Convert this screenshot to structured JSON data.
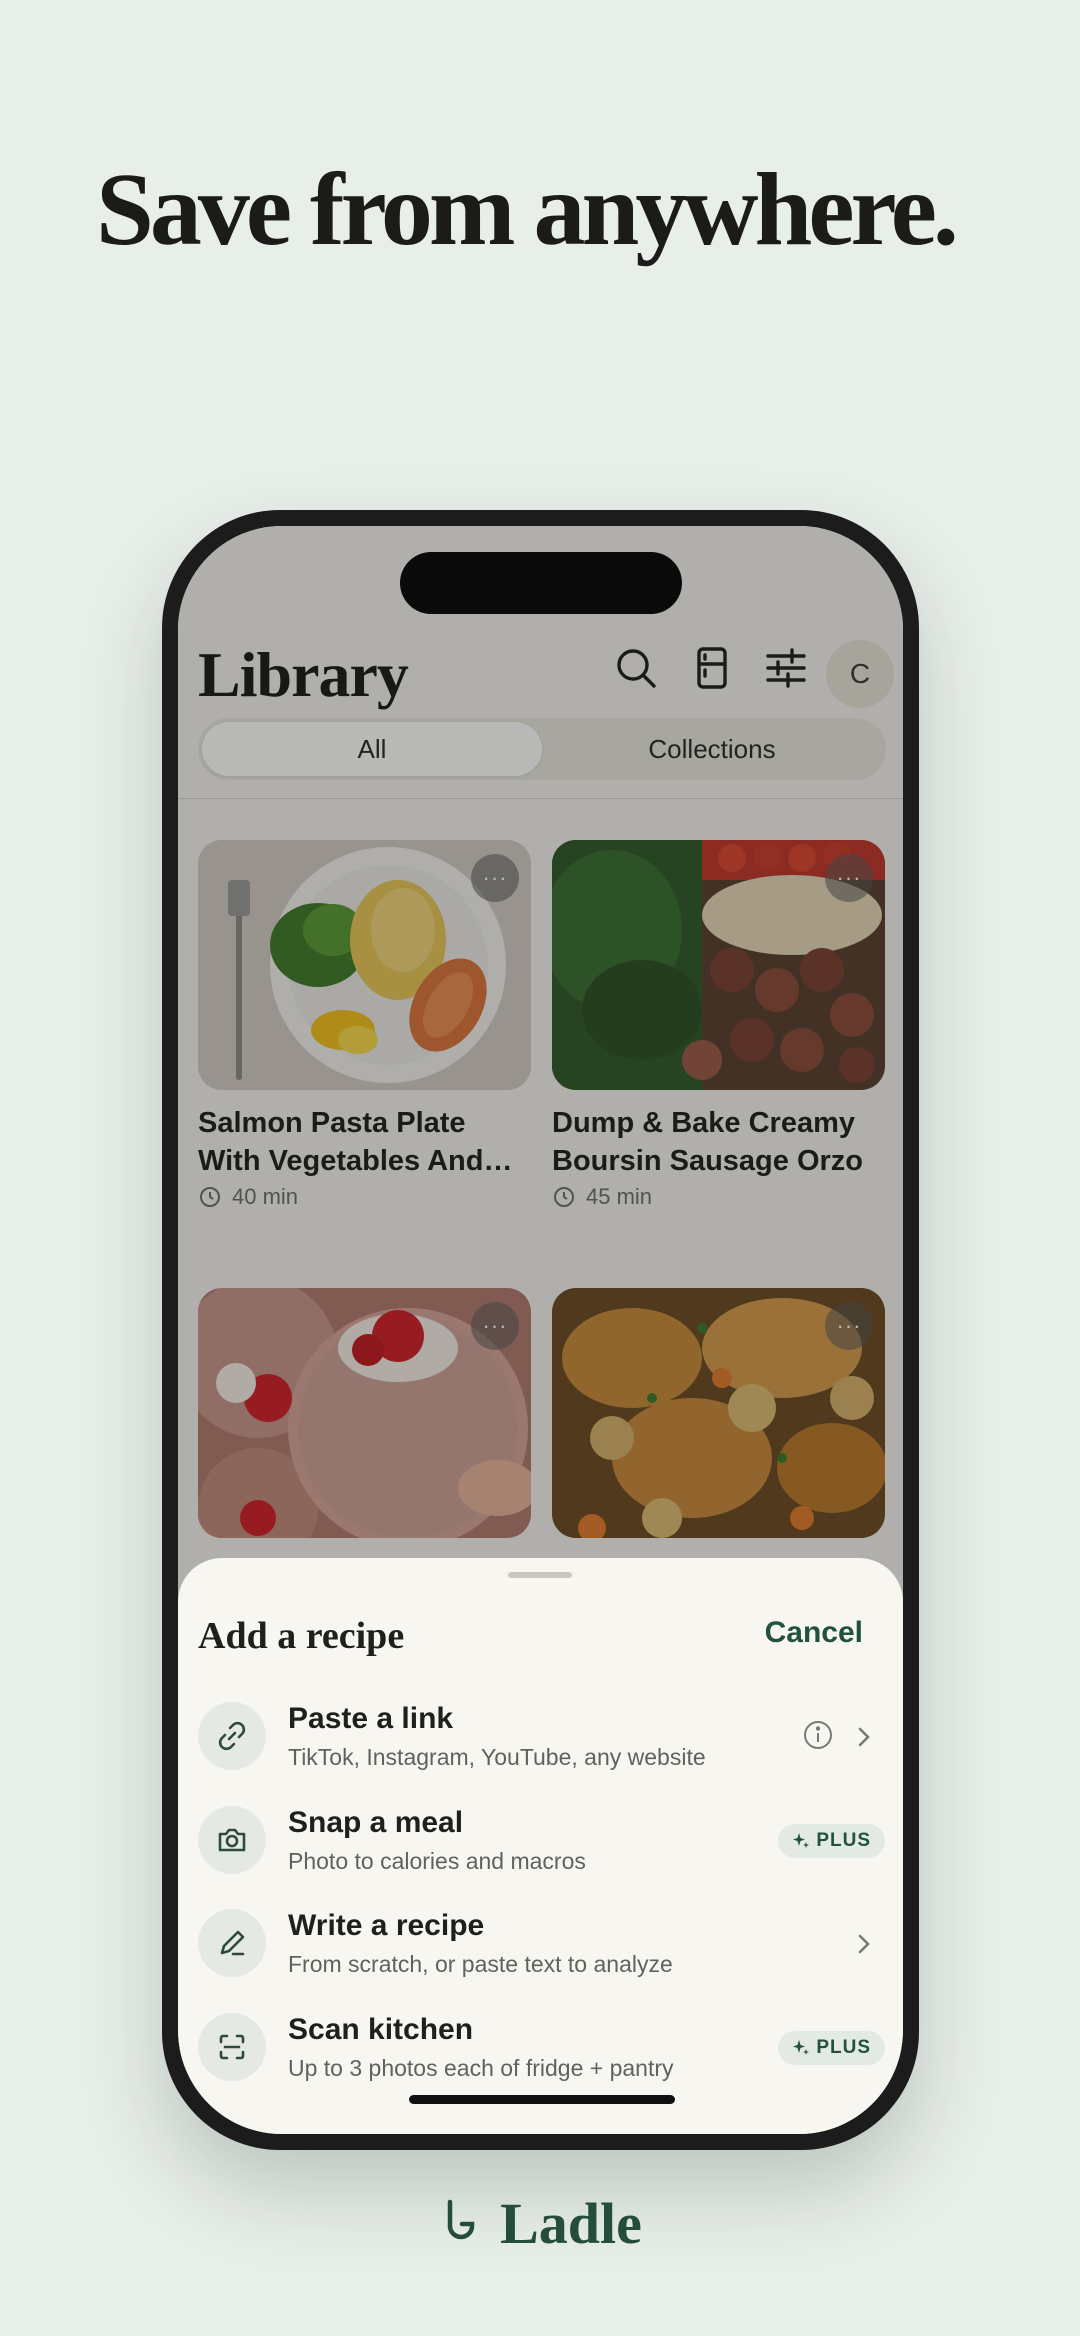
{
  "headline": "Save from anywhere.",
  "library": {
    "title": "Library",
    "avatar_initial": "C",
    "tabs": [
      {
        "label": "All",
        "active": true
      },
      {
        "label": "Collections",
        "active": false
      }
    ],
    "recipes": [
      {
        "title": "Salmon Pasta Plate With Vegetables And…",
        "time": "40 min"
      },
      {
        "title": "Dump & Bake Creamy Boursin Sausage Orzo",
        "time": "45 min"
      },
      {
        "title": "",
        "time": ""
      },
      {
        "title": "",
        "time": ""
      }
    ],
    "more_label": "···"
  },
  "sheet": {
    "title": "Add a recipe",
    "cancel_label": "Cancel",
    "options": [
      {
        "title": "Paste a link",
        "subtitle": "TikTok, Instagram, YouTube, any website",
        "icon": "link-icon"
      },
      {
        "title": "Snap a meal",
        "subtitle": "Photo to calories and macros",
        "icon": "camera-icon",
        "badge": "PLUS"
      },
      {
        "title": "Write a recipe",
        "subtitle": "From scratch, or paste text to analyze",
        "icon": "pencil-icon"
      },
      {
        "title": "Scan kitchen",
        "subtitle": "Up to 3 photos each of fridge + pantry",
        "icon": "scan-icon",
        "badge": "PLUS"
      }
    ]
  },
  "brand": {
    "name": "Ladle"
  },
  "colors": {
    "accent": "#22513e",
    "background": "#e8eee9",
    "sheet": "#f7f6f1"
  }
}
